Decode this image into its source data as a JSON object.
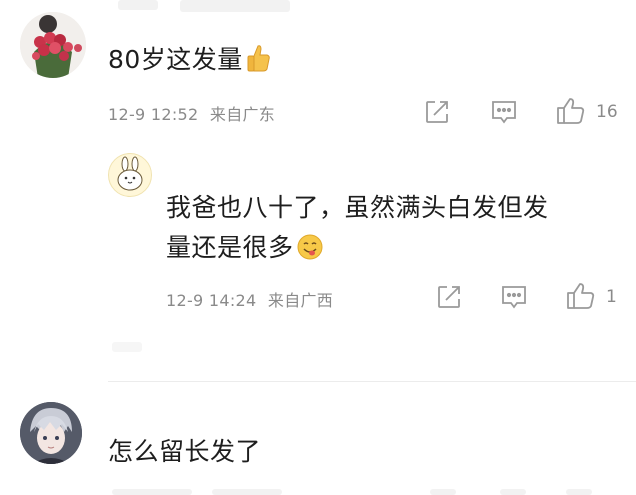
{
  "comments": [
    {
      "text": "80岁这发量",
      "emoji": "thumbs-up",
      "time": "12-9 12:52",
      "location": "来自广东",
      "likes": "16"
    },
    {
      "text_line1": "我爸也八十了，虽然满头白发但发",
      "text_line2": "量还是很多",
      "emoji": "yum-face",
      "time": "12-9 14:24",
      "location": "来自广西",
      "likes": "1"
    },
    {
      "text": "怎么留长发了"
    }
  ],
  "colors": {
    "icon": "#9a9a9a",
    "meta": "#8a8a8a",
    "text": "#1e1e1e"
  }
}
